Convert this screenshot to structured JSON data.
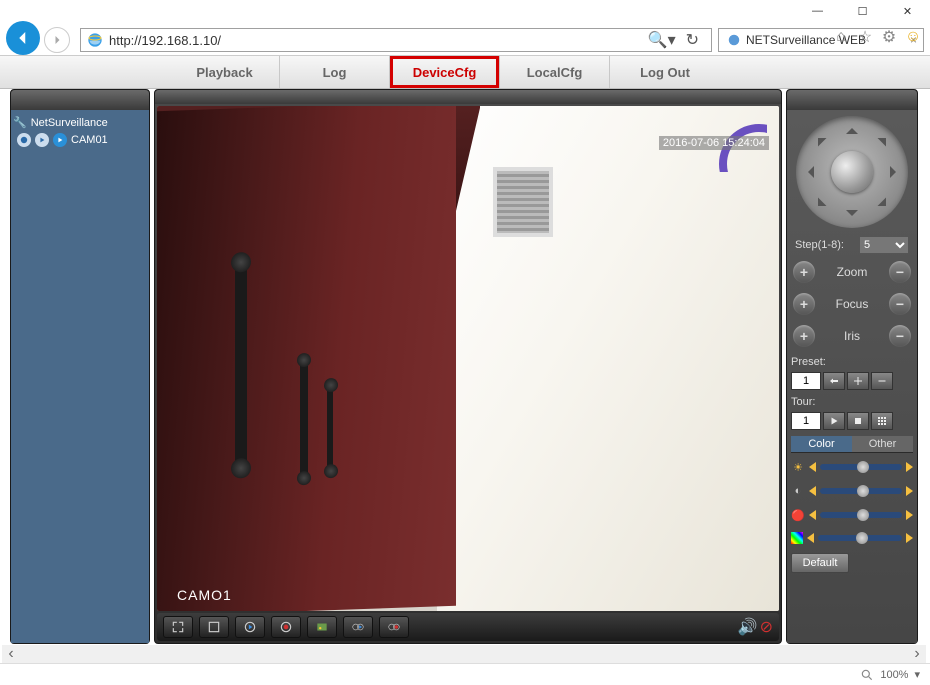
{
  "window": {
    "min": "—",
    "max": "☐",
    "close": "✕"
  },
  "browser": {
    "url": "http://192.168.1.10/",
    "tab_title": "NETSurveillance WEB",
    "zoom": "100%"
  },
  "menu": {
    "playback": "Playback",
    "log": "Log",
    "devicecfg": "DeviceCfg",
    "localcfg": "LocalCfg",
    "logout": "Log Out"
  },
  "sidebar": {
    "root": "NetSurveillance",
    "cam": "CAM01"
  },
  "video": {
    "timestamp": "2016-07-06 15:24:04",
    "label": "CAMO1"
  },
  "ptz": {
    "step_label": "Step(1-8):",
    "step_value": "5",
    "zoom": "Zoom",
    "focus": "Focus",
    "iris": "Iris",
    "preset_label": "Preset:",
    "preset_value": "1",
    "tour_label": "Tour:",
    "tour_value": "1"
  },
  "color": {
    "tab_color": "Color",
    "tab_other": "Other",
    "default": "Default"
  }
}
